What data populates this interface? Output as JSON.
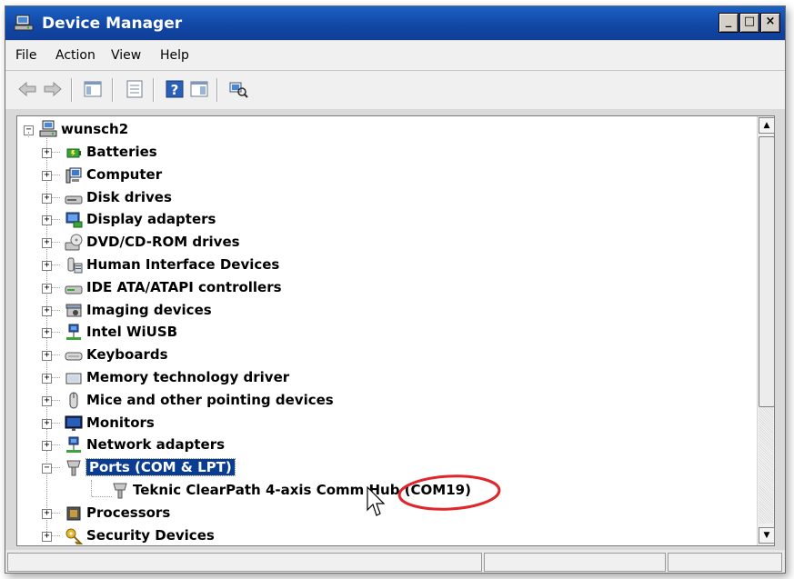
{
  "window": {
    "title": "Device Manager",
    "buttons": [
      "_",
      "□",
      "×"
    ]
  },
  "menu": [
    "File",
    "Action",
    "View",
    "Help"
  ],
  "toolbar": {
    "buttons": [
      "back-arrow-icon",
      "forward-arrow-icon",
      "show-hide-tree-icon",
      "properties-icon",
      "help-icon",
      "action-pane-icon",
      "scan-hardware-icon"
    ]
  },
  "tree": {
    "root": "wunsch2",
    "items": [
      {
        "label": "Batteries",
        "icon": "battery-icon"
      },
      {
        "label": "Computer",
        "icon": "computer-icon"
      },
      {
        "label": "Disk drives",
        "icon": "disk-drive-icon"
      },
      {
        "label": "Display adapters",
        "icon": "display-adapter-icon"
      },
      {
        "label": "DVD/CD-ROM drives",
        "icon": "dvd-drive-icon"
      },
      {
        "label": "Human Interface Devices",
        "icon": "hid-icon"
      },
      {
        "label": "IDE ATA/ATAPI controllers",
        "icon": "ide-controller-icon"
      },
      {
        "label": "Imaging devices",
        "icon": "camera-icon"
      },
      {
        "label": "Intel WiUSB",
        "icon": "network-icon"
      },
      {
        "label": "Keyboards",
        "icon": "keyboard-icon"
      },
      {
        "label": "Memory technology driver",
        "icon": "memory-icon"
      },
      {
        "label": "Mice and other pointing devices",
        "icon": "mouse-icon"
      },
      {
        "label": "Monitors",
        "icon": "monitor-icon"
      },
      {
        "label": "Network adapters",
        "icon": "network-adapter-icon"
      },
      {
        "label": "Ports (COM & LPT)",
        "icon": "port-icon",
        "expanded": true,
        "selected": true
      },
      {
        "label": "Teknic ClearPath 4-axis Comm Hub (COM19)",
        "icon": "port-icon",
        "child": true
      },
      {
        "label": "Processors",
        "icon": "processor-icon"
      },
      {
        "label": "Security Devices",
        "icon": "key-icon"
      }
    ]
  },
  "colors": {
    "titlebar": "#1247a6",
    "selection": "#0a3d91",
    "highlight_circle": "#e0262b"
  }
}
